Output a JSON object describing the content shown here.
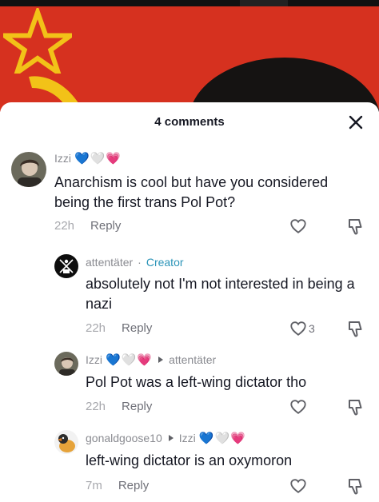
{
  "sheet": {
    "title": "4 comments"
  },
  "icons": {
    "close": "close-icon",
    "heart": "heart-outline-icon",
    "dislike": "thumbs-down-icon"
  },
  "colors": {
    "creator_tag": "#2b94b8",
    "video_background": "#d6311f",
    "emoji_blue": "#7cc8f5",
    "emoji_white": "#e9e9e9",
    "emoji_pink": "#e83f96"
  },
  "comments": [
    {
      "username": "Izzi",
      "emojis": [
        "💙",
        "🤍",
        "💗"
      ],
      "text": "Anarchism is cool but have you considered being the first trans Pol Pot?",
      "time": "22h",
      "reply_label": "Reply",
      "likes": ""
    },
    {
      "username": "attentäter",
      "creator_label": "Creator",
      "text": "absolutely not I'm not interested in being a nazi",
      "time": "22h",
      "reply_label": "Reply",
      "likes": "3"
    },
    {
      "username": "Izzi",
      "emojis": [
        "💙",
        "🤍",
        "💗"
      ],
      "reply_to": "attentäter",
      "text": "Pol Pot was a left-wing dictator tho",
      "time": "22h",
      "reply_label": "Reply",
      "likes": ""
    },
    {
      "username": "gonaldgoose10",
      "reply_to": "Izzi",
      "reply_to_emojis": [
        "💙",
        "🤍",
        "💗"
      ],
      "text": "left-wing dictator is an oxymoron",
      "time": "7m",
      "reply_label": "Reply",
      "likes": ""
    }
  ]
}
